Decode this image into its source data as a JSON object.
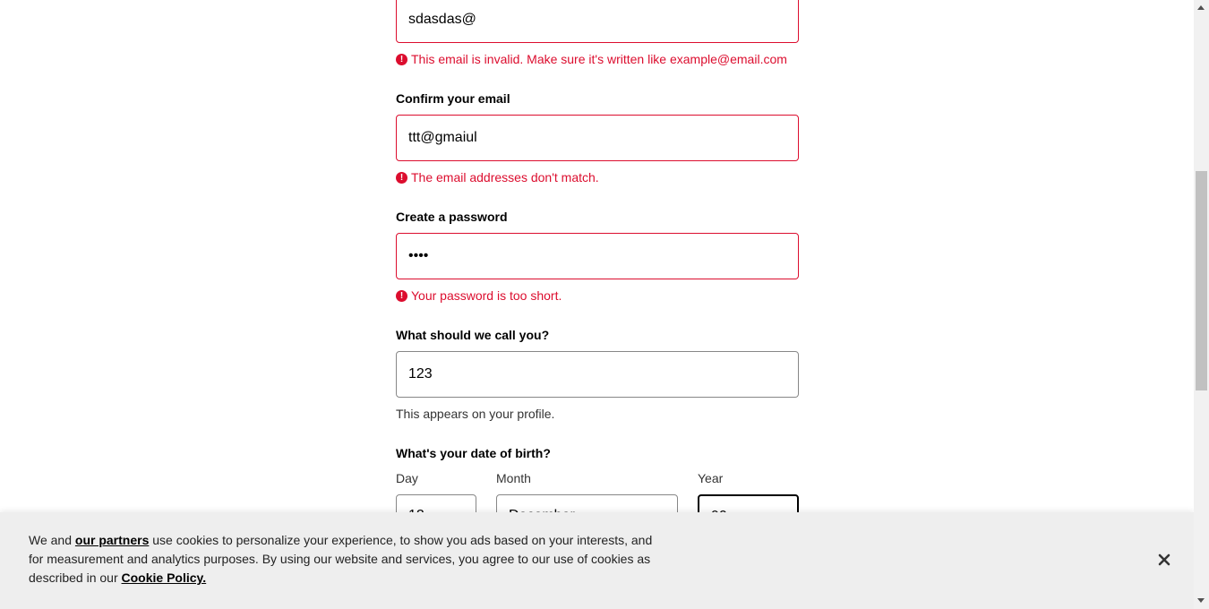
{
  "form": {
    "email": {
      "value": "sdasdas@",
      "error": "This email is invalid. Make sure it's written like example@email.com"
    },
    "confirm_email": {
      "label": "Confirm your email",
      "value": "ttt@gmaiul",
      "error": "The email addresses don't match."
    },
    "password": {
      "label": "Create a password",
      "value": "1234",
      "error": "Your password is too short."
    },
    "display_name": {
      "label": "What should we call you?",
      "value": "123",
      "hint": "This appears on your profile."
    },
    "dob": {
      "label": "What's your date of birth?",
      "day_label": "Day",
      "month_label": "Month",
      "year_label": "Year",
      "day_value": "12",
      "month_value": "December",
      "year_value": "90"
    },
    "error_icon_glyph": "!"
  },
  "cookie_banner": {
    "text_before": "We and ",
    "partners_link": "our partners",
    "text_middle": " use cookies to personalize your experience, to show you ads based on your interests, and for measurement and analytics purposes. By using our website and services, you agree to our use of cookies as described in our ",
    "policy_link": "Cookie Policy.",
    "close_icon": "close-icon"
  },
  "colors": {
    "error": "#dc0d2e",
    "banner_bg": "#eeeeee"
  }
}
